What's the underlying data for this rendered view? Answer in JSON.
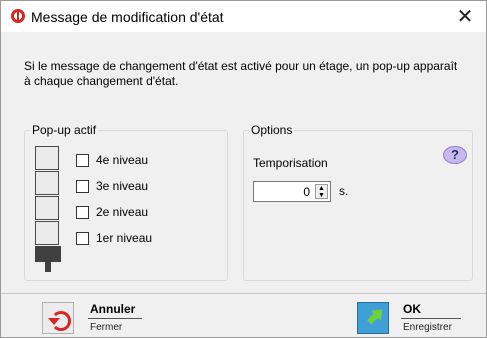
{
  "window": {
    "title": "Message de modification d'état",
    "close_glyph": "✕"
  },
  "description": "Si le message de changement d'état est activé pour un étage, un pop-up apparaît à chaque changement d'état.",
  "popup_group": {
    "legend": "Pop-up actif",
    "levels": [
      {
        "label": "4e niveau",
        "checked": false
      },
      {
        "label": "3e niveau",
        "checked": false
      },
      {
        "label": "2e niveau",
        "checked": false
      },
      {
        "label": "1er niveau",
        "checked": false
      }
    ]
  },
  "options_group": {
    "legend": "Options",
    "help_glyph": "?",
    "delay_label": "Temporisation",
    "delay_value": "0",
    "delay_unit": "s."
  },
  "actions": {
    "cancel": {
      "label": "Annuler",
      "sublabel": "Fermer"
    },
    "ok": {
      "label": "OK",
      "sublabel": "Enregistrer"
    }
  }
}
